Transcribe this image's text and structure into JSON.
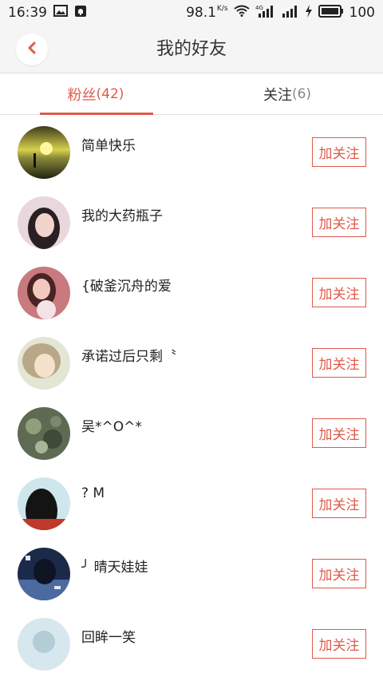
{
  "status_bar": {
    "time": "16:39",
    "speed": "98.1",
    "speed_unit": "K/s",
    "network": "4G",
    "battery": "100"
  },
  "header": {
    "title": "我的好友"
  },
  "tabs": [
    {
      "label": "粉丝",
      "count": "(42)"
    },
    {
      "label": "关注",
      "count": "(6)"
    }
  ],
  "friends": [
    {
      "name": "简单快乐",
      "follow_label": "加关注"
    },
    {
      "name": "我的大药瓶子",
      "follow_label": "加关注"
    },
    {
      "name": "{破釜沉舟的爱",
      "follow_label": "加关注"
    },
    {
      "name": "承诺过后只剩〝",
      "follow_label": "加关注"
    },
    {
      "name": "吴*^O^*",
      "follow_label": "加关注"
    },
    {
      "name": "? M",
      "follow_label": "加关注"
    },
    {
      "name": "╯ 晴天娃娃",
      "follow_label": "加关注"
    },
    {
      "name": "回眸一笑",
      "follow_label": "加关注"
    }
  ],
  "colors": {
    "accent": "#e05a4a",
    "header_bg": "#f5f5f5"
  }
}
